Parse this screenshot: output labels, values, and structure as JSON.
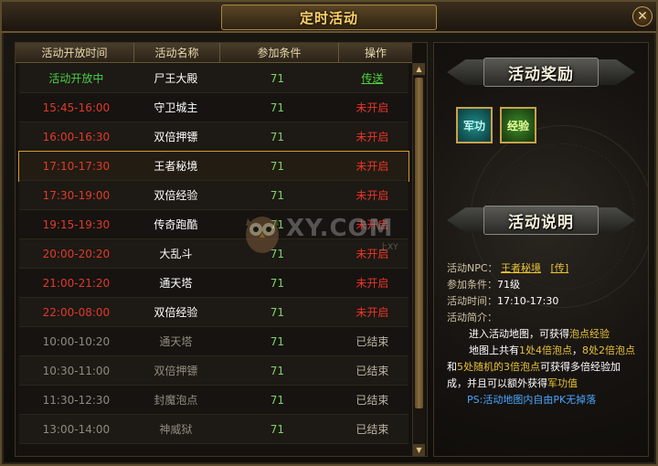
{
  "window": {
    "title": "定时活动",
    "close_label": "✕"
  },
  "table": {
    "headers": [
      "活动开放时间",
      "活动名称",
      "参加条件",
      "操作"
    ],
    "rows": [
      {
        "time": "活动开放中",
        "name": "尸王大殿",
        "level": "71",
        "action": "传送",
        "state": "open"
      },
      {
        "time": "15:45-16:00",
        "name": "守卫城主",
        "level": "71",
        "action": "未开启",
        "state": "pending"
      },
      {
        "time": "16:00-16:30",
        "name": "双倍押镖",
        "level": "71",
        "action": "未开启",
        "state": "pending"
      },
      {
        "time": "17:10-17:30",
        "name": "王者秘境",
        "level": "71",
        "action": "未开启",
        "state": "pending",
        "selected": true
      },
      {
        "time": "17:30-19:00",
        "name": "双倍经验",
        "level": "71",
        "action": "未开启",
        "state": "pending"
      },
      {
        "time": "19:15-19:30",
        "name": "传奇跑酷",
        "level": "71",
        "action": "未开启",
        "state": "pending"
      },
      {
        "time": "20:00-20:20",
        "name": "大乱斗",
        "level": "71",
        "action": "未开启",
        "state": "pending"
      },
      {
        "time": "21:00-21:20",
        "name": "通天塔",
        "level": "71",
        "action": "未开启",
        "state": "pending"
      },
      {
        "time": "22:00-08:00",
        "name": "双倍经验",
        "level": "71",
        "action": "未开启",
        "state": "pending"
      },
      {
        "time": "10:00-10:20",
        "name": "通天塔",
        "level": "71",
        "action": "已结束",
        "state": "ended"
      },
      {
        "time": "10:30-11:00",
        "name": "双倍押镖",
        "level": "71",
        "action": "已结束",
        "state": "ended"
      },
      {
        "time": "11:30-12:30",
        "name": "封魔泡点",
        "level": "71",
        "action": "已结束",
        "state": "ended"
      },
      {
        "time": "13:00-14:00",
        "name": "神威狱",
        "level": "71",
        "action": "已结束",
        "state": "ended"
      }
    ]
  },
  "scrollbar": {
    "up": "▲",
    "down": "▼"
  },
  "watermark": {
    "text": "XY.COM",
    "sub": "上XY"
  },
  "rewards": {
    "banner": "活动奖励",
    "items": [
      {
        "label": "军功",
        "icon": "military-merit-icon"
      },
      {
        "label": "经验",
        "icon": "experience-icon"
      }
    ]
  },
  "description": {
    "banner": "活动说明",
    "npc_label": "活动NPC：",
    "npc_value": "王者秘境",
    "npc_transfer": "[传]",
    "cond_label": "参加条件：",
    "cond_value": "71级",
    "time_label": "活动时间：",
    "time_value": "17:10-17:30",
    "intro_label": "活动简介：",
    "line1_a": "进入活动地图，可获得",
    "line1_b": "泡点经验",
    "line2_a": "地图上共有",
    "line2_b": "1处4倍泡点",
    "line2_c": "，",
    "line2_d": "8处2倍泡点",
    "line3_a": "和",
    "line3_b": "5处随机的3倍泡点",
    "line3_c": "可获得多倍经验加",
    "line4_a": "成，并且可以额外获得",
    "line4_b": "军功值",
    "ps": "PS:活动地图内自由PK无掉落"
  },
  "colors": {
    "accent": "#d59b2c",
    "open": "#48d048",
    "pending": "#e03a2a",
    "ended": "#8f8a80"
  }
}
